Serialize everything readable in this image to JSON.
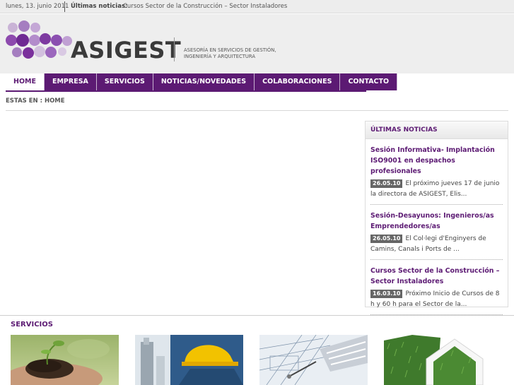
{
  "topbar": {
    "date": "lunes, 13. junio 2011",
    "news_label": "Últimas noticias:",
    "news_link": "Cursos Sector de la Construcción – Sector Instaladores"
  },
  "header": {
    "brand": "ASIGEST",
    "tagline_line1": "Asesoría en servicios de gestión,",
    "tagline_line2": "ingeniería y arquitectura",
    "brand_color": "#5c1a73"
  },
  "nav": {
    "items": [
      {
        "label": "HOME",
        "active": true
      },
      {
        "label": "EMPRESA"
      },
      {
        "label": "SERVICIOS"
      },
      {
        "label": "NOTICIAS/NOVEDADES"
      },
      {
        "label": "COLABORACIONES"
      },
      {
        "label": "CONTACTO"
      }
    ]
  },
  "breadcrumb": "ESTAS EN : HOME",
  "sidebar": {
    "title": "ÚLTIMAS NOTICIAS",
    "news": [
      {
        "title": "Sesión Informativa- Implantación ISO9001 en despachos profesionales",
        "date": "26.05.10",
        "excerpt": "El próximo jueves 17 de junio la directora de ASIGEST, Elis..."
      },
      {
        "title": "Sesión-Desayunos: Ingenieros/as Emprendedores/as",
        "date": "26.05.10",
        "excerpt": "El Col·legi d'Enginyers de Camins, Canals i Ports de ..."
      },
      {
        "title": "Cursos Sector de la Construcción – Sector Instaladores",
        "date": "16.03.10",
        "excerpt": "Próximo Inicio de Cursos de 8 h y 60 h para el Sector de la..."
      }
    ]
  },
  "services": {
    "title": "SERVICIOS",
    "images": [
      "hands-seedling-image",
      "hardhat-worker-image",
      "blueprint-laptop-image",
      "grass-house-image"
    ]
  }
}
